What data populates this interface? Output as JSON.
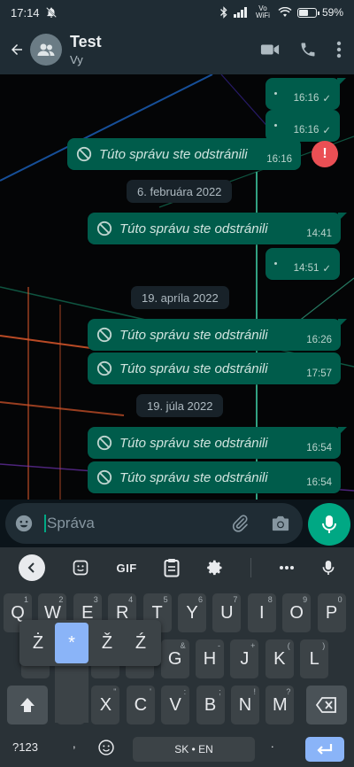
{
  "status_bar": {
    "time": "17:14",
    "network_label": "Vo WiFi",
    "battery": "59%",
    "battery_level": 0.59
  },
  "header": {
    "back_icon": "arrow-left-icon",
    "avatar_icon": "group-icon",
    "title": "Test",
    "subtitle": "Vy",
    "actions": [
      "video-call-icon",
      "phone-icon",
      "more-vert-icon"
    ]
  },
  "messages": [
    {
      "type": "sent",
      "text": "",
      "time": "16:16",
      "status": "✓"
    },
    {
      "type": "sent",
      "text": "",
      "time": "16:16",
      "status": "✓"
    },
    {
      "type": "deleted",
      "text": "Túto správu ste odstránili",
      "time": "16:16",
      "error": "!"
    },
    {
      "type": "date",
      "text": "6. februára 2022"
    },
    {
      "type": "deleted",
      "text": "Túto správu ste odstránili",
      "time": "14:41"
    },
    {
      "type": "sent",
      "text": "",
      "time": "14:51",
      "status": "✓"
    },
    {
      "type": "date",
      "text": "19. apríla 2022"
    },
    {
      "type": "deleted",
      "text": "Túto správu ste odstránili",
      "time": "16:26"
    },
    {
      "type": "deleted",
      "text": "Túto správu ste odstránili",
      "time": "17:57"
    },
    {
      "type": "date",
      "text": "19. júla 2022"
    },
    {
      "type": "deleted",
      "text": "Túto správu ste odstránili",
      "time": "16:54"
    },
    {
      "type": "deleted",
      "text": "Túto správu ste odstránili",
      "time": "16:54"
    }
  ],
  "composer": {
    "placeholder": "Správa",
    "emoji_icon": "emoji-icon",
    "attach_icon": "paperclip-icon",
    "camera_icon": "camera-icon",
    "mic_icon": "microphone-icon"
  },
  "keyboard": {
    "toolbar": {
      "gif": "GIF"
    },
    "row1": [
      "Q",
      "W",
      "E",
      "R",
      "T",
      "Y",
      "U",
      "I",
      "O",
      "P"
    ],
    "row1_hints": [
      "1",
      "2",
      "3",
      "4",
      "5",
      "6",
      "7",
      "8",
      "9",
      "0"
    ],
    "row2": [
      "A",
      "S",
      "D",
      "F",
      "G",
      "H",
      "J",
      "K",
      "L"
    ],
    "row2_hints": [
      "@",
      "#",
      "$",
      "_",
      "&",
      "-",
      "+",
      "(",
      ")"
    ],
    "row3": [
      "Z",
      "X",
      "C",
      "V",
      "B",
      "N",
      "M"
    ],
    "row3_hints": [
      "*",
      "\"",
      "'",
      ":",
      ";",
      "!",
      "?"
    ],
    "popup": [
      "Ż",
      "*",
      "Ž",
      "Ź"
    ],
    "symbols_label": "?123",
    "space_label": "SK • EN",
    "comma": ",",
    "period": "."
  },
  "colors": {
    "accent": "#00a884",
    "bubble": "#005c4b",
    "header": "#1f2c34",
    "error": "#ea4f54"
  }
}
